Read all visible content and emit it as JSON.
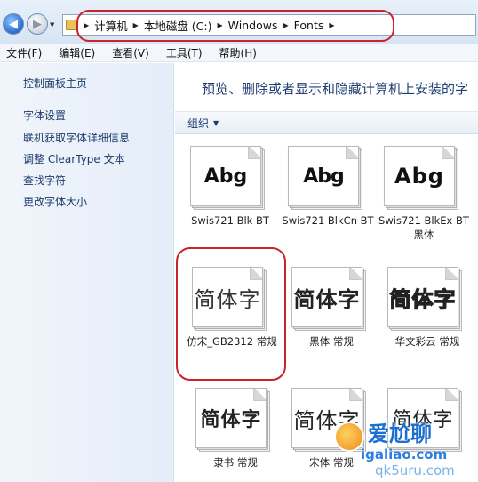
{
  "address_bar": {
    "breadcrumbs": [
      "计算机",
      "本地磁盘 (C:)",
      "Windows",
      "Fonts"
    ]
  },
  "menu": [
    "文件(F)",
    "编辑(E)",
    "查看(V)",
    "工具(T)",
    "帮助(H)"
  ],
  "sidebar": {
    "title": "控制面板主页",
    "links": [
      "字体设置",
      "联机获取字体详细信息",
      "调整 ClearType 文本",
      "查找字符",
      "更改字体大小"
    ]
  },
  "main": {
    "heading": "预览、删除或者显示和隐藏计算机上安装的字",
    "organize_label": "组织",
    "fonts": [
      {
        "sample": "Abg",
        "label": "Swis721 Blk BT"
      },
      {
        "sample": "Abg",
        "label": "Swis721 BlkCn BT"
      },
      {
        "sample": "Abg",
        "label": "Swis721 BlkEx BT 黑体"
      },
      {
        "sample": "简体字",
        "label": "仿宋_GB2312 常规"
      },
      {
        "sample": "简体字",
        "label": "黑体 常规"
      },
      {
        "sample": "简体字",
        "label": "华文彩云 常规"
      },
      {
        "sample": "简体字",
        "label": "隶书 常规"
      },
      {
        "sample": "简体字",
        "label": "宋体 常规"
      },
      {
        "sample": "简体字",
        "label": ""
      }
    ]
  },
  "watermark": {
    "text": "爱尬聊",
    "url": "igaliao.com",
    "url2": "qk5uru.com"
  },
  "colors": {
    "highlight": "#c9232c",
    "link": "#1b3a6b",
    "heading": "#1f3f73"
  }
}
